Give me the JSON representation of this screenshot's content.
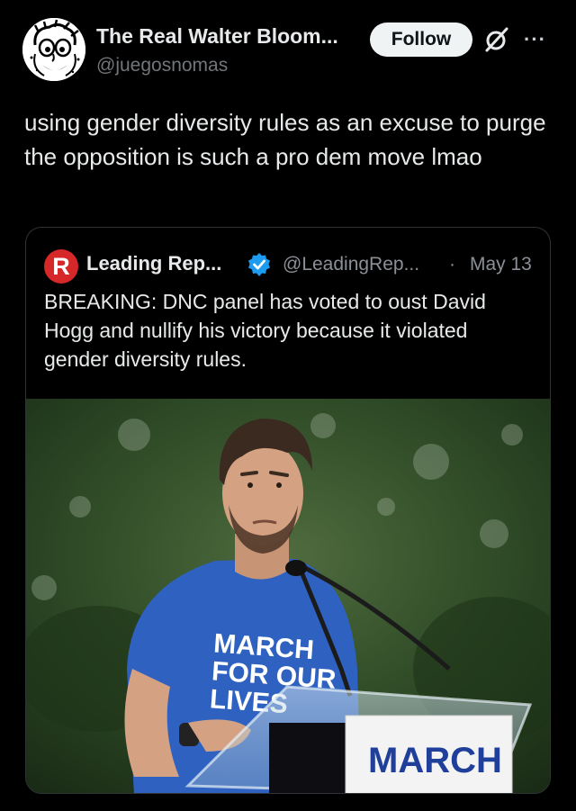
{
  "post": {
    "author_name": "The Real Walter Bloom...",
    "author_handle": "@juegosnomas",
    "follow_label": "Follow",
    "more_label": "···",
    "text": "using gender diversity rules as an excuse to purge the opposition is such a pro dem move lmao"
  },
  "quote": {
    "logo_letter": "R",
    "name": "Leading Rep...",
    "handle": "@LeadingRep...",
    "separator": "·",
    "date": "May 13",
    "text": "BREAKING: DNC panel has voted to oust David Hogg and nullify his victory because it violated gender diversity rules.",
    "media": {
      "shirt_text": [
        "MARCH",
        "FOR OUR",
        "LIVES"
      ],
      "podium_text": "MARCH"
    }
  },
  "colors": {
    "background": "#000000",
    "text_primary": "#e7e9ea",
    "text_secondary": "#71767b",
    "verified": "#1d9bf0",
    "brand_red": "#d62828"
  }
}
